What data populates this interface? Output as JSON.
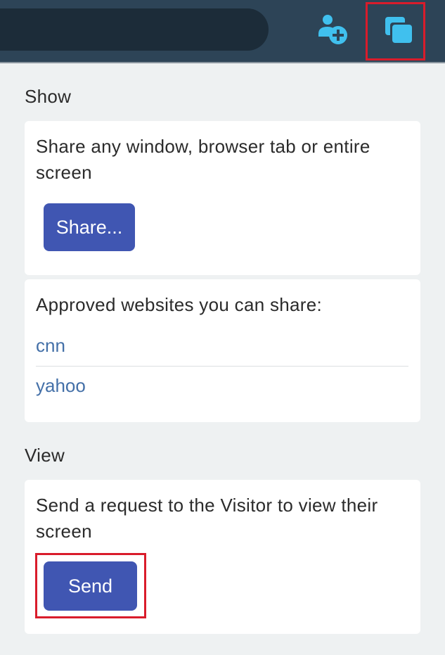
{
  "header": {
    "add_person_icon": "add-person-icon",
    "share_screen_icon": "screen-share-icon",
    "colors": {
      "background": "#2d4457",
      "icon": "#40c0ee",
      "highlight": "#d91c2b"
    }
  },
  "show": {
    "title": "Show",
    "share_card": {
      "text": "Share any window, browser tab or entire screen",
      "button_label": "Share..."
    },
    "approved_card": {
      "heading": "Approved websites you can share:",
      "sites": [
        "cnn",
        "yahoo"
      ]
    }
  },
  "view": {
    "title": "View",
    "request_card": {
      "text": "Send a request to the Visitor to view their screen",
      "button_label": "Send"
    }
  },
  "colors": {
    "primary_button": "#4056b2",
    "link": "#4470a8",
    "page_background": "#eef1f2"
  }
}
